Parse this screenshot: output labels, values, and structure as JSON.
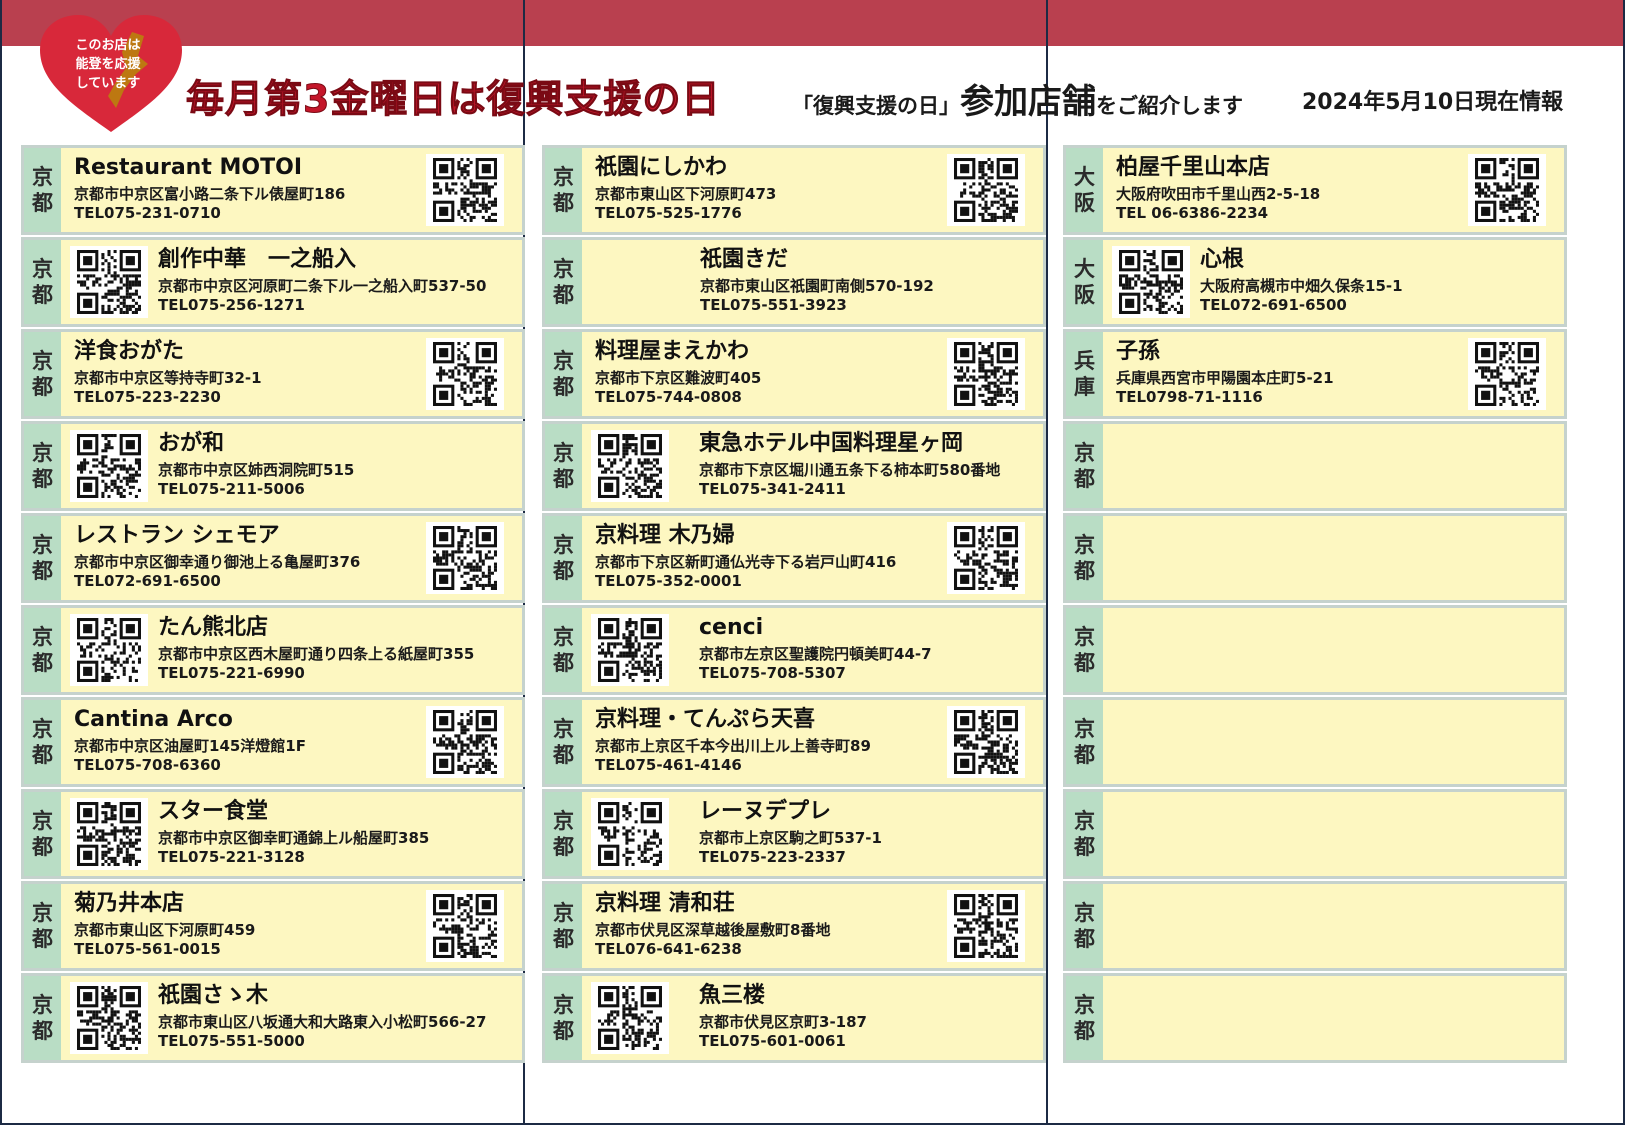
{
  "badge": {
    "line1": "このお店は",
    "line2": "能登を応援",
    "line3": "しています"
  },
  "headline": "毎月第3金曜日は復興支援の日",
  "subhead": {
    "pre": "「復興支援の日」",
    "big": "参加店舗",
    "post": "をご紹介します"
  },
  "as_of": "2024年5月10日現在情報",
  "colors": {
    "band": "#b9404f",
    "card_bg": "#fdf7c1",
    "pref_bg": "#b9ddc5",
    "headline": "#c4162a",
    "heart": "#d8283a"
  },
  "columns": [
    {
      "stores": [
        {
          "pref": [
            "京",
            "都"
          ],
          "name": "Restaurant MOTOI",
          "address": "京都市中京区富小路二条下ル俵屋町186",
          "tel": "TEL075-231-0710",
          "qr": "right"
        },
        {
          "pref": [
            "京",
            "都"
          ],
          "name": "創作中華　一之船入",
          "address": "京都市中京区河原町二条下ル一之船入町537-50",
          "tel": "TEL075-256-1271",
          "qr": "left"
        },
        {
          "pref": [
            "京",
            "都"
          ],
          "name": "洋食おがた",
          "address": "京都市中京区等持寺町32-1",
          "tel": "TEL075-223-2230",
          "qr": "right"
        },
        {
          "pref": [
            "京",
            "都"
          ],
          "name": "おが和",
          "address": "京都市中京区姉西洞院町515",
          "tel": "TEL075-211-5006",
          "qr": "left"
        },
        {
          "pref": [
            "京",
            "都"
          ],
          "name": "レストラン シェモア",
          "address": "京都市中京区御幸通り御池上る亀屋町376",
          "tel": "TEL072-691-6500",
          "qr": "right"
        },
        {
          "pref": [
            "京",
            "都"
          ],
          "name": "たん熊北店",
          "address": "京都市中京区西木屋町通り四条上る紙屋町355",
          "tel": "TEL075-221-6990",
          "qr": "left"
        },
        {
          "pref": [
            "京",
            "都"
          ],
          "name": "Cantina Arco",
          "address": "京都市中京区油屋町145洋燈館1F",
          "tel": "TEL075-708-6360",
          "qr": "right"
        },
        {
          "pref": [
            "京",
            "都"
          ],
          "name": "スター食堂",
          "address": "京都市中京区御幸町通錦上ル船屋町385",
          "tel": "TEL075-221-3128",
          "qr": "left"
        },
        {
          "pref": [
            "京",
            "都"
          ],
          "name": "菊乃井本店",
          "address": "京都市東山区下河原町459",
          "tel": "TEL075-561-0015",
          "qr": "right"
        },
        {
          "pref": [
            "京",
            "都"
          ],
          "name": "祇園さゝ木",
          "address": "京都市東山区八坂通大和大路東入小松町566-27",
          "tel": "TEL075-551-5000",
          "qr": "left"
        }
      ]
    },
    {
      "stores": [
        {
          "pref": [
            "京",
            "都"
          ],
          "name": "祇園にしかわ",
          "address": "京都市東山区下河原町473",
          "tel": "TEL075-525-1776",
          "qr": "right"
        },
        {
          "pref": [
            "京",
            "都"
          ],
          "name": "祇園きだ",
          "address": "京都市東山区祇園町南側570-192",
          "tel": "TEL075-551-3923",
          "qr": "none"
        },
        {
          "pref": [
            "京",
            "都"
          ],
          "name": "料理屋まえかわ",
          "address": "京都市下京区難波町405",
          "tel": "TEL075-744-0808",
          "qr": "right"
        },
        {
          "pref": [
            "京",
            "都"
          ],
          "name": "東急ホテル中国料理星ヶ岡",
          "address": "京都市下京区堀川通五条下る柿本町580番地",
          "tel": "TEL075-341-2411",
          "qr": "left"
        },
        {
          "pref": [
            "京",
            "都"
          ],
          "name": "京料理 木乃婦",
          "address": "京都市下京区新町通仏光寺下る岩戸山町416",
          "tel": "TEL075-352-0001",
          "qr": "right"
        },
        {
          "pref": [
            "京",
            "都"
          ],
          "name": "cenci",
          "address": "京都市左京区聖護院円頓美町44-7",
          "tel": "TEL075-708-5307",
          "qr": "left"
        },
        {
          "pref": [
            "京",
            "都"
          ],
          "name": "京料理・てんぷら天喜",
          "address": "京都市上京区千本今出川上ル上善寺町89",
          "tel": "TEL075-461-4146",
          "qr": "right"
        },
        {
          "pref": [
            "京",
            "都"
          ],
          "name": "レーヌデプレ",
          "address": "京都市上京区駒之町537-1",
          "tel": "TEL075-223-2337",
          "qr": "left"
        },
        {
          "pref": [
            "京",
            "都"
          ],
          "name": "京料理 清和荘",
          "address": "京都市伏見区深草越後屋敷町8番地",
          "tel": "TEL076-641-6238",
          "qr": "right"
        },
        {
          "pref": [
            "京",
            "都"
          ],
          "name": "魚三楼",
          "address": "京都市伏見区京町3-187",
          "tel": "TEL075-601-0061",
          "qr": "left"
        }
      ]
    },
    {
      "stores": [
        {
          "pref": [
            "大",
            "阪"
          ],
          "name": "柏屋千里山本店",
          "address": "大阪府吹田市千里山西2-5-18",
          "tel": "TEL 06-6386-2234",
          "qr": "right"
        },
        {
          "pref": [
            "大",
            "阪"
          ],
          "name": "心根",
          "address": "大阪府高槻市中畑久保条15-1",
          "tel": "TEL072-691-6500",
          "qr": "left"
        },
        {
          "pref": [
            "兵",
            "庫"
          ],
          "name": "子孫",
          "address": "兵庫県西宮市甲陽園本庄町5-21",
          "tel": "TEL0798-71-1116",
          "qr": "right"
        },
        {
          "pref": [
            "京",
            "都"
          ],
          "name": "",
          "address": "",
          "tel": "",
          "qr": "none"
        },
        {
          "pref": [
            "京",
            "都"
          ],
          "name": "",
          "address": "",
          "tel": "",
          "qr": "none"
        },
        {
          "pref": [
            "京",
            "都"
          ],
          "name": "",
          "address": "",
          "tel": "",
          "qr": "none"
        },
        {
          "pref": [
            "京",
            "都"
          ],
          "name": "",
          "address": "",
          "tel": "",
          "qr": "none"
        },
        {
          "pref": [
            "京",
            "都"
          ],
          "name": "",
          "address": "",
          "tel": "",
          "qr": "none"
        },
        {
          "pref": [
            "京",
            "都"
          ],
          "name": "",
          "address": "",
          "tel": "",
          "qr": "none"
        },
        {
          "pref": [
            "京",
            "都"
          ],
          "name": "",
          "address": "",
          "tel": "",
          "qr": "none"
        }
      ]
    }
  ]
}
